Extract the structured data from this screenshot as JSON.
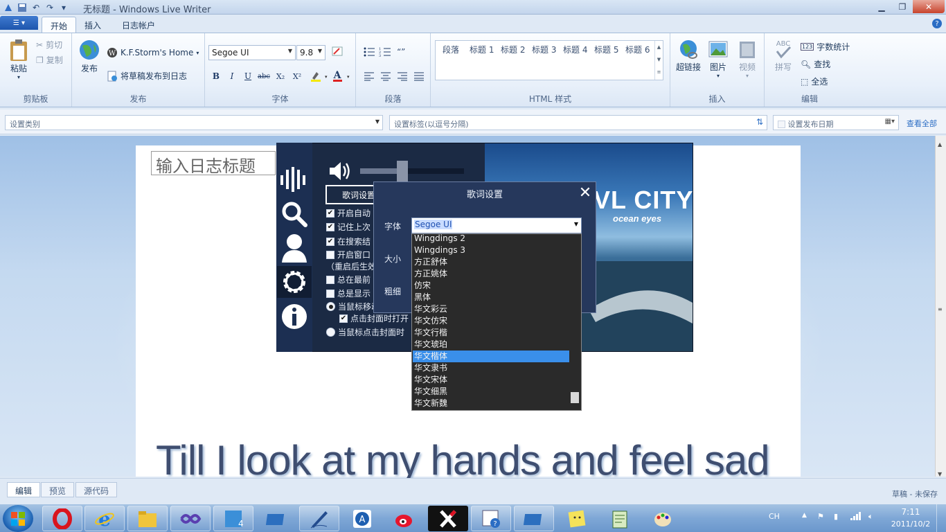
{
  "window": {
    "title": "无标题 - Windows Live Writer"
  },
  "ribbon": {
    "tabs": [
      "开始",
      "插入",
      "日志帐户"
    ],
    "clipboard": {
      "paste": "粘贴",
      "cut": "剪切",
      "copy": "复制",
      "group": "剪贴板"
    },
    "publish": {
      "publish": "发布",
      "account": "K.F.Storm's Home",
      "publish_draft": "将草稿发布到日志",
      "group": "发布"
    },
    "font": {
      "family": "Segoe UI",
      "size": "9.8",
      "group": "字体",
      "bold": "B",
      "italic": "I",
      "underline": "U",
      "strike": "abc",
      "subscript": "X₂",
      "superscript": "X²",
      "font_color": "A"
    },
    "paragraph": {
      "group": "段落"
    },
    "html_styles": {
      "items": [
        "段落",
        "标题 1",
        "标题 2",
        "标题 3",
        "标题 4",
        "标题 5",
        "标题 6"
      ],
      "group": "HTML 样式"
    },
    "insert": {
      "hyperlink": "超链接",
      "picture": "图片",
      "video": "视频",
      "group": "插入"
    },
    "edit": {
      "spelling": "拼写",
      "spelling_icon": "ABC",
      "word_count": "字数统计",
      "find": "查找",
      "select_all": "全选",
      "group": "编辑"
    }
  },
  "properties": {
    "category_placeholder": "设置类别",
    "tags_placeholder": "设置标签(以逗号分隔)",
    "publish_date": "设置发布日期",
    "view_all": "查看全部"
  },
  "editor": {
    "title_placeholder": "输入日志标题",
    "lyric_line": "Till I look at my hands and feel sad"
  },
  "player": {
    "album_title": "VL CITY",
    "album_subtitle": "ocean eyes",
    "settings_button": "歌词设置",
    "options": [
      {
        "label": "开启自动",
        "checked": true
      },
      {
        "label": "记住上次",
        "checked": true
      },
      {
        "label": "在搜索结",
        "checked": true
      },
      {
        "label": "开启窗口",
        "checked": false
      },
      {
        "label": "（重启后生效",
        "checked": null
      },
      {
        "label": "总在最前",
        "checked": false
      },
      {
        "label": "总是显示",
        "checked": false
      }
    ],
    "radio1": "当鼠标移动",
    "sub_option": "点击封面时打开",
    "radio2": "当鼠标点击封面时",
    "overlap_text": "面"
  },
  "lyric_dialog": {
    "title": "歌词设置",
    "font_label": "字体",
    "size_label": "大小",
    "weight_label": "粗细",
    "font_value": "Segoe UI",
    "font_options": [
      "Wingdings 2",
      "Wingdings 3",
      "方正舒体",
      "方正姚体",
      "仿宋",
      "黑体",
      "华文彩云",
      "华文仿宋",
      "华文行楷",
      "华文琥珀",
      "华文楷体",
      "华文隶书",
      "华文宋体",
      "华文细黑",
      "华文新魏"
    ],
    "selected_option": "华文楷体"
  },
  "bottom_tabs": [
    "编辑",
    "预览",
    "源代码"
  ],
  "status": "草稿 - 未保存",
  "taskbar": {
    "ime": "CH",
    "time": "7:11",
    "date": "2011/10/2"
  }
}
